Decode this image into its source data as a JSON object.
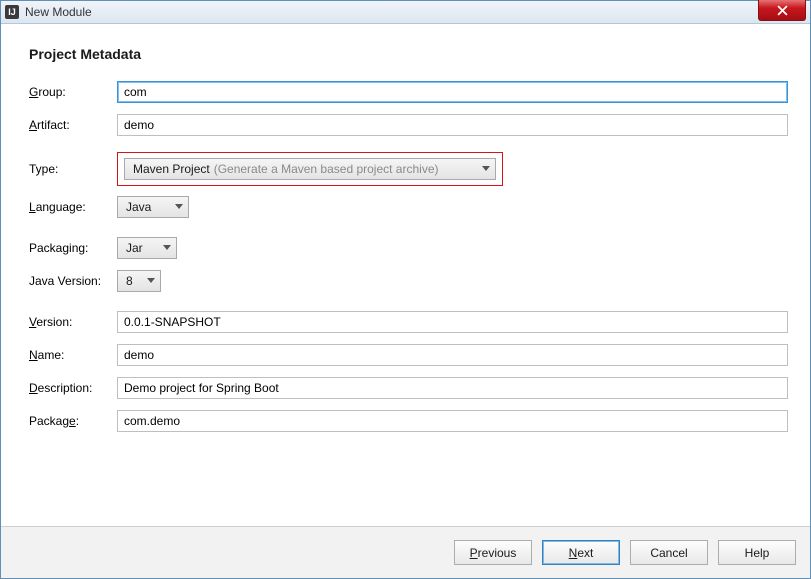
{
  "window": {
    "title": "New Module",
    "app_icon_text": "IJ"
  },
  "heading": "Project Metadata",
  "labels": {
    "group": "roup:",
    "artifact": "rtifact:",
    "type": "Type:",
    "language": "anguage:",
    "packaging": "Packaging:",
    "java_version": "Java Version:",
    "version": "ersion:",
    "name": "ame:",
    "description": "escription:",
    "package": "Packag"
  },
  "mnemonics": {
    "group": "G",
    "artifact": "A",
    "language": "L",
    "version": "V",
    "name": "N",
    "description": "D",
    "package_tail": "e"
  },
  "values": {
    "group": "com",
    "artifact": "demo",
    "type_main": "Maven Project",
    "type_hint": "(Generate a Maven based project archive)",
    "language": "Java",
    "packaging": "Jar",
    "java_version": "8",
    "version": "0.0.1-SNAPSHOT",
    "name": "demo",
    "description": "Demo project for Spring Boot",
    "package": "com.demo"
  },
  "buttons": {
    "previous": "revious",
    "previous_m": "P",
    "next": "ext",
    "next_m": "N",
    "cancel": "Cancel",
    "help": "Help"
  }
}
